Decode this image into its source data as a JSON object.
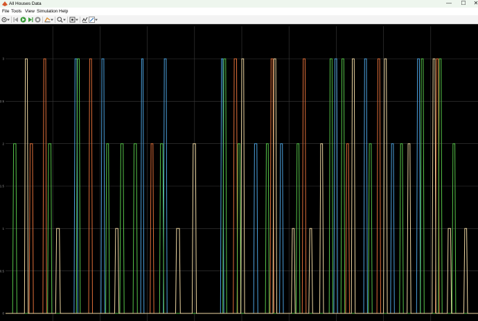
{
  "window": {
    "title": "All Houses Data",
    "controls": {
      "minimize": "—",
      "maximize": "☐",
      "close": "✕"
    }
  },
  "menu": {
    "items": [
      "File",
      "Tools",
      "View",
      "Simulation",
      "Help"
    ]
  },
  "toolbar": {
    "icons": [
      "settings-icon",
      "dropdown-arrow-icon",
      "step-back-icon",
      "run-icon",
      "step-forward-icon",
      "stop-icon",
      "highlight-icon",
      "dropdown-arrow-icon",
      "zoom-icon",
      "dropdown-arrow-icon",
      "autoscale-icon",
      "dropdown-arrow-icon",
      "signal-statistics-icon",
      "edit-icon",
      "dropdown-arrow-icon"
    ]
  },
  "chart_data": {
    "type": "line",
    "title": "",
    "xlabel": "",
    "ylabel": "",
    "ylim": [
      0,
      3
    ],
    "xlim": [
      0,
      100
    ],
    "yticks": [
      "0",
      "0.5",
      "1",
      "1.5",
      "2",
      "2.5",
      "3"
    ],
    "grid": true,
    "colors": {
      "background": "#000000",
      "grid": "#3c3c3c",
      "ticks": "#9a9a9a"
    },
    "series": [
      {
        "color": "#4da3e0",
        "x": [
          0,
          14.5,
          14.7,
          15.1,
          15.3,
          20.2,
          20.4,
          20.8,
          21.0,
          28.6,
          28.8,
          29.1,
          29.3,
          33.4,
          33.6,
          34.0,
          34.2,
          45.5,
          45.7,
          46.0,
          46.2,
          52.5,
          52.7,
          53.2,
          53.4,
          58.0,
          58.2,
          58.6,
          58.8,
          69.5,
          69.7,
          70.1,
          70.3,
          75.8,
          76.0,
          76.4,
          76.6,
          81.5,
          81.7,
          82.1,
          82.3,
          87.0,
          87.2,
          87.6,
          87.8,
          100
        ],
        "y": [
          0,
          0,
          3,
          3,
          0,
          0,
          3,
          3,
          0,
          0,
          3,
          3,
          0,
          0,
          3,
          3,
          0,
          0,
          3,
          3,
          0,
          0,
          2,
          2,
          0,
          0,
          2,
          2,
          0,
          0,
          3,
          3,
          0,
          0,
          3,
          3,
          0,
          0,
          2,
          2,
          0,
          0,
          3,
          3,
          0,
          0
        ]
      },
      {
        "color": "#e2703a",
        "x": [
          0,
          5.0,
          5.2,
          5.7,
          5.9,
          7.9,
          8.1,
          8.5,
          8.7,
          17.6,
          17.8,
          18.2,
          18.4,
          30.6,
          30.8,
          31.2,
          31.4,
          48.2,
          48.4,
          48.9,
          49.1,
          56.0,
          56.2,
          56.6,
          56.8,
          62.8,
          63.0,
          63.4,
          63.6,
          72.0,
          72.2,
          72.6,
          72.8,
          78.6,
          78.8,
          79.2,
          79.4,
          91.0,
          91.2,
          91.6,
          91.8,
          100
        ],
        "y": [
          0,
          0,
          2,
          2,
          0,
          0,
          3,
          3,
          0,
          0,
          3,
          3,
          0,
          0,
          2,
          2,
          0,
          0,
          3,
          3,
          0,
          0,
          3,
          3,
          0,
          0,
          3,
          3,
          0,
          0,
          2,
          2,
          0,
          0,
          3,
          3,
          0,
          0,
          3,
          3,
          0,
          0
        ]
      },
      {
        "color": "#57c64a",
        "x": [
          0,
          1.5,
          1.7,
          2.2,
          2.4,
          8.9,
          9.1,
          9.6,
          9.8,
          15.0,
          15.2,
          15.6,
          15.8,
          21.2,
          21.4,
          21.8,
          22.0,
          24.2,
          24.4,
          24.9,
          25.1,
          27.0,
          27.2,
          27.7,
          27.9,
          32.6,
          32.8,
          33.3,
          33.5,
          46.0,
          46.2,
          46.6,
          46.8,
          49.0,
          49.2,
          49.6,
          49.8,
          55.0,
          55.2,
          55.6,
          55.8,
          61.5,
          61.7,
          62.1,
          62.3,
          68.5,
          68.7,
          69.1,
          69.3,
          71.0,
          71.2,
          71.6,
          71.8,
          76.8,
          77.0,
          77.4,
          77.6,
          83.4,
          83.6,
          84.0,
          84.2,
          87.8,
          88.0,
          88.4,
          88.6,
          91.6,
          91.8,
          92.2,
          92.4,
          94.5,
          94.7,
          95.1,
          95.3,
          100
        ],
        "y": [
          0,
          0,
          2,
          2,
          0,
          0,
          2,
          2,
          0,
          0,
          3,
          3,
          0,
          0,
          2,
          2,
          0,
          0,
          2,
          2,
          0,
          0,
          2,
          2,
          0,
          0,
          2,
          2,
          0,
          0,
          3,
          3,
          0,
          0,
          2,
          2,
          0,
          0,
          2,
          2,
          0,
          0,
          2,
          2,
          0,
          0,
          3,
          3,
          0,
          0,
          3,
          3,
          0,
          0,
          2,
          2,
          0,
          0,
          2,
          2,
          0,
          0,
          3,
          3,
          0,
          0,
          3,
          3,
          0,
          0,
          2,
          2,
          0,
          0
        ]
      },
      {
        "color": "#f0d9a3",
        "x": [
          0,
          4.0,
          4.2,
          4.6,
          4.8,
          10.6,
          10.8,
          11.4,
          11.6,
          23.1,
          23.3,
          23.8,
          24.0,
          36.0,
          36.2,
          36.8,
          37.0,
          39.5,
          39.7,
          40.2,
          40.4,
          49.8,
          50.0,
          50.4,
          50.6,
          56.6,
          56.8,
          57.2,
          57.4,
          60.5,
          60.7,
          61.1,
          61.3,
          64.2,
          64.4,
          64.8,
          65.0,
          66.5,
          66.7,
          67.1,
          67.3,
          73.2,
          73.4,
          73.8,
          74.0,
          80.0,
          80.2,
          80.6,
          80.8,
          85.0,
          85.2,
          85.6,
          85.8,
          90.3,
          90.5,
          90.9,
          91.1,
          93.5,
          93.7,
          94.2,
          94.4,
          97.0,
          97.2,
          97.6,
          97.8,
          100
        ],
        "y": [
          0,
          0,
          3,
          3,
          0,
          0,
          1,
          1,
          0,
          0,
          1,
          1,
          0,
          0,
          1,
          1,
          0,
          0,
          2,
          2,
          0,
          0,
          3,
          3,
          0,
          0,
          3,
          3,
          0,
          0,
          1,
          1,
          0,
          0,
          1,
          1,
          0,
          0,
          2,
          2,
          0,
          0,
          3,
          3,
          0,
          0,
          3,
          3,
          0,
          0,
          2,
          2,
          0,
          0,
          3,
          3,
          0,
          0,
          1,
          1,
          0,
          0,
          1,
          1,
          0,
          0
        ]
      }
    ]
  }
}
